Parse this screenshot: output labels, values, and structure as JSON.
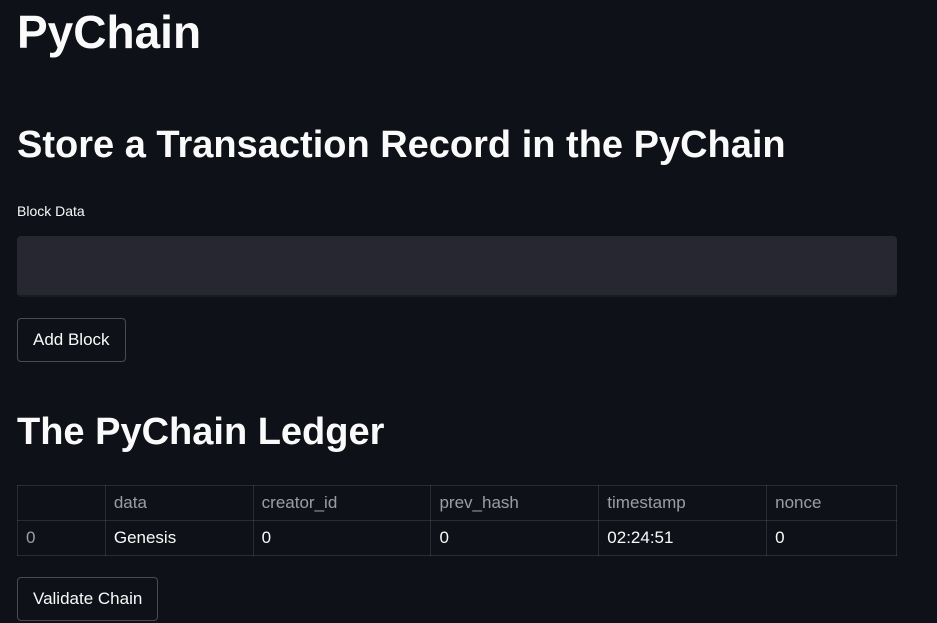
{
  "app": {
    "title": "PyChain"
  },
  "store_section": {
    "heading": "Store a Transaction Record in the PyChain",
    "block_data_label": "Block Data",
    "block_data_value": "",
    "add_block_label": "Add Block"
  },
  "ledger_section": {
    "heading": "The PyChain Ledger",
    "columns": [
      "",
      "data",
      "creator_id",
      "prev_hash",
      "timestamp",
      "nonce"
    ],
    "rows": [
      {
        "index": "0",
        "data": "Genesis",
        "creator_id": "0",
        "prev_hash": "0",
        "timestamp": "02:24:51",
        "nonce": "0"
      }
    ],
    "validate_label": "Validate Chain"
  },
  "theme": {
    "background": "#0e1117",
    "input_background": "#262730",
    "text": "#fafafa"
  }
}
